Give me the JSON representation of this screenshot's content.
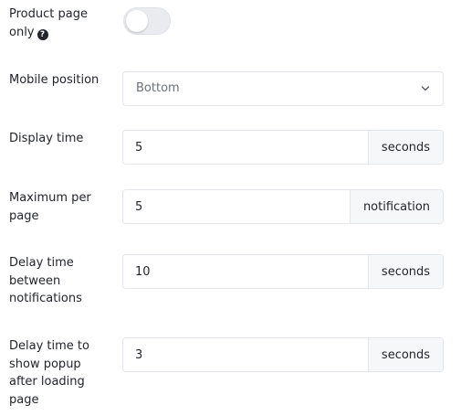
{
  "product_page_only": {
    "label": "Product page only",
    "help_icon": "question-circle-icon",
    "enabled": false
  },
  "mobile_position": {
    "label": "Mobile position",
    "value": "Bottom",
    "icon": "chevron-down-icon"
  },
  "display_time": {
    "label": "Display time",
    "value": "5",
    "unit": "seconds"
  },
  "maximum_per_page": {
    "label": "Maximum per page",
    "value": "5",
    "unit": "notification"
  },
  "delay_between": {
    "label": "Delay time between notifications",
    "value": "10",
    "unit": "seconds"
  },
  "delay_after_loading": {
    "label": "Delay time to show popup after loading page",
    "value": "3",
    "unit": "seconds"
  }
}
